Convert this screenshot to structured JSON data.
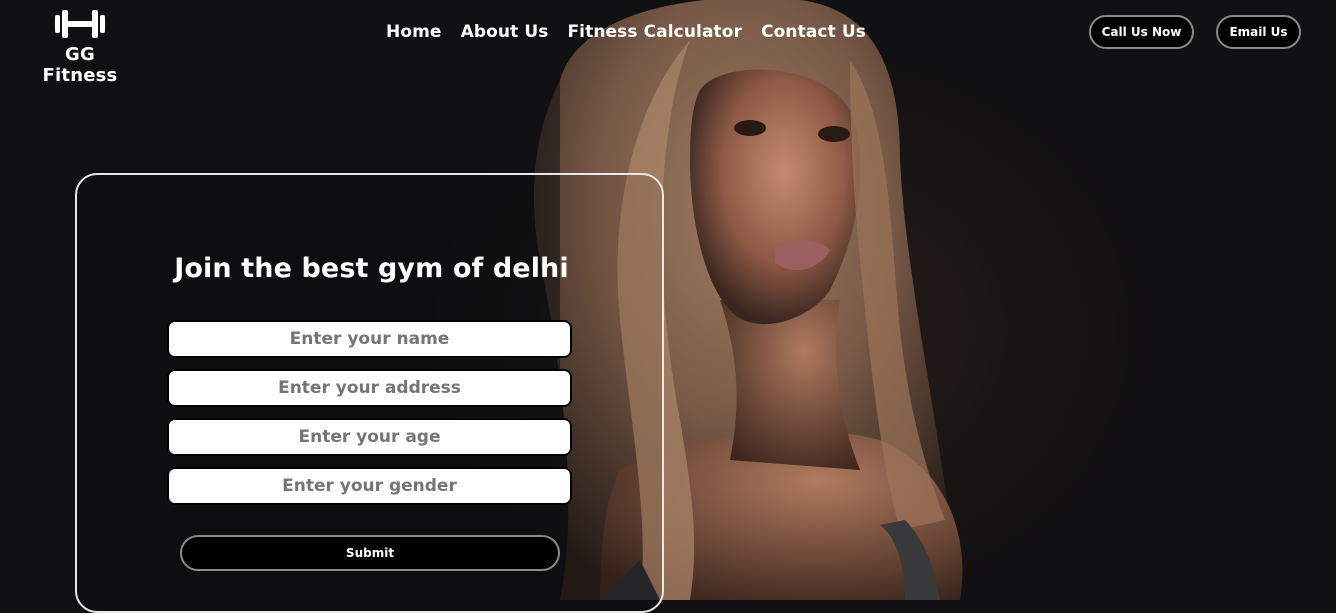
{
  "brand": {
    "name": "GG Fitness",
    "logo_icon": "dumbbell-icon"
  },
  "nav": {
    "items": [
      {
        "label": "Home"
      },
      {
        "label": "About Us"
      },
      {
        "label": "Fitness Calculator"
      },
      {
        "label": "Contact Us"
      }
    ]
  },
  "header_actions": {
    "call_label": "Call Us Now",
    "email_label": "Email Us"
  },
  "form": {
    "title": "Join the best gym of delhi",
    "fields": [
      {
        "placeholder": "Enter your name",
        "value": ""
      },
      {
        "placeholder": "Enter your address",
        "value": ""
      },
      {
        "placeholder": "Enter your age",
        "value": ""
      },
      {
        "placeholder": "Enter your gender",
        "value": ""
      }
    ],
    "submit_label": "Submit"
  },
  "colors": {
    "background": "#111012",
    "text": "#ffffff",
    "button_bg": "#000000",
    "button_border": "#8a8a8a",
    "card_border": "#e8e8e8"
  }
}
